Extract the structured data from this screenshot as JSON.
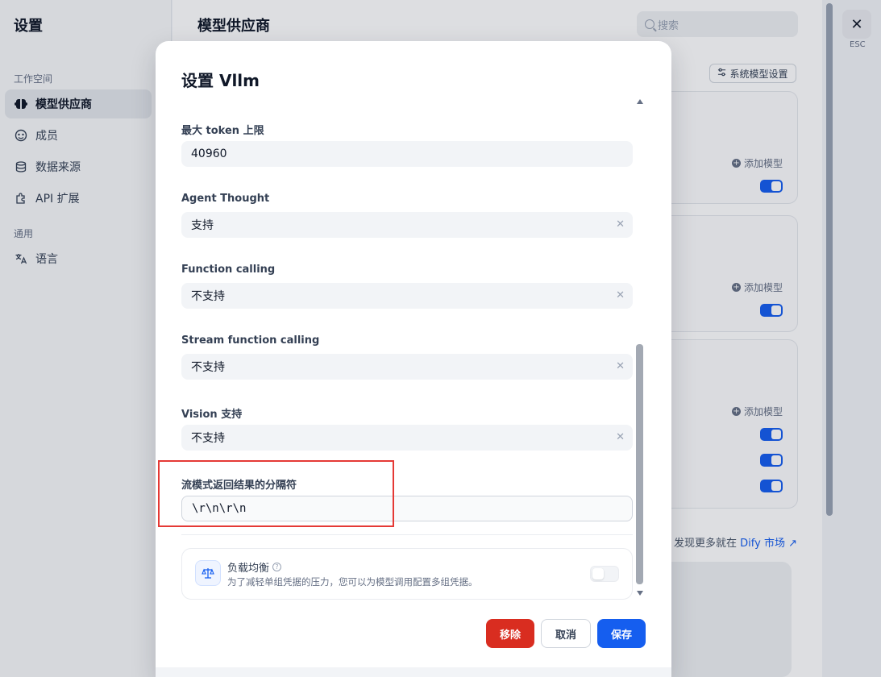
{
  "sidebar": {
    "title": "设置",
    "workspace_group": "工作空间",
    "general_group": "通用",
    "items": [
      {
        "label": "模型供应商",
        "icon": "brain-icon"
      },
      {
        "label": "成员",
        "icon": "members-icon"
      },
      {
        "label": "数据来源",
        "icon": "database-icon"
      },
      {
        "label": "API 扩展",
        "icon": "puzzle-icon"
      },
      {
        "label": "语言",
        "icon": "translate-icon"
      }
    ]
  },
  "main": {
    "title": "模型供应商",
    "search_placeholder": "搜索",
    "system_model_settings": "系统模型设置",
    "add_model": "添加模型",
    "discover_more": "发现更多就在",
    "marketplace_link": "Dify 市场 ↗"
  },
  "close": {
    "esc": "ESC"
  },
  "modal": {
    "title": "设置 Vllm",
    "fields": {
      "max_tokens": {
        "label": "最大 token 上限",
        "value": "40960"
      },
      "agent_thought": {
        "label": "Agent Thought",
        "value": "支持"
      },
      "function_calling": {
        "label": "Function calling",
        "value": "不支持"
      },
      "stream_function_calling": {
        "label": "Stream function calling",
        "value": "不支持"
      },
      "vision": {
        "label": "Vision 支持",
        "value": "不支持"
      },
      "stream_delimiter": {
        "label": "流模式返回结果的分隔符",
        "value": "\\r\\n\\r\\n"
      }
    },
    "load_balancing": {
      "title": "负载均衡",
      "description": "为了减轻单组凭据的压力，您可以为模型调用配置多组凭据。",
      "enabled": false
    },
    "buttons": {
      "remove": "移除",
      "cancel": "取消",
      "save": "保存"
    }
  },
  "colors": {
    "primary": "#155eef",
    "danger": "#d92d20",
    "highlight": "#e53935"
  }
}
